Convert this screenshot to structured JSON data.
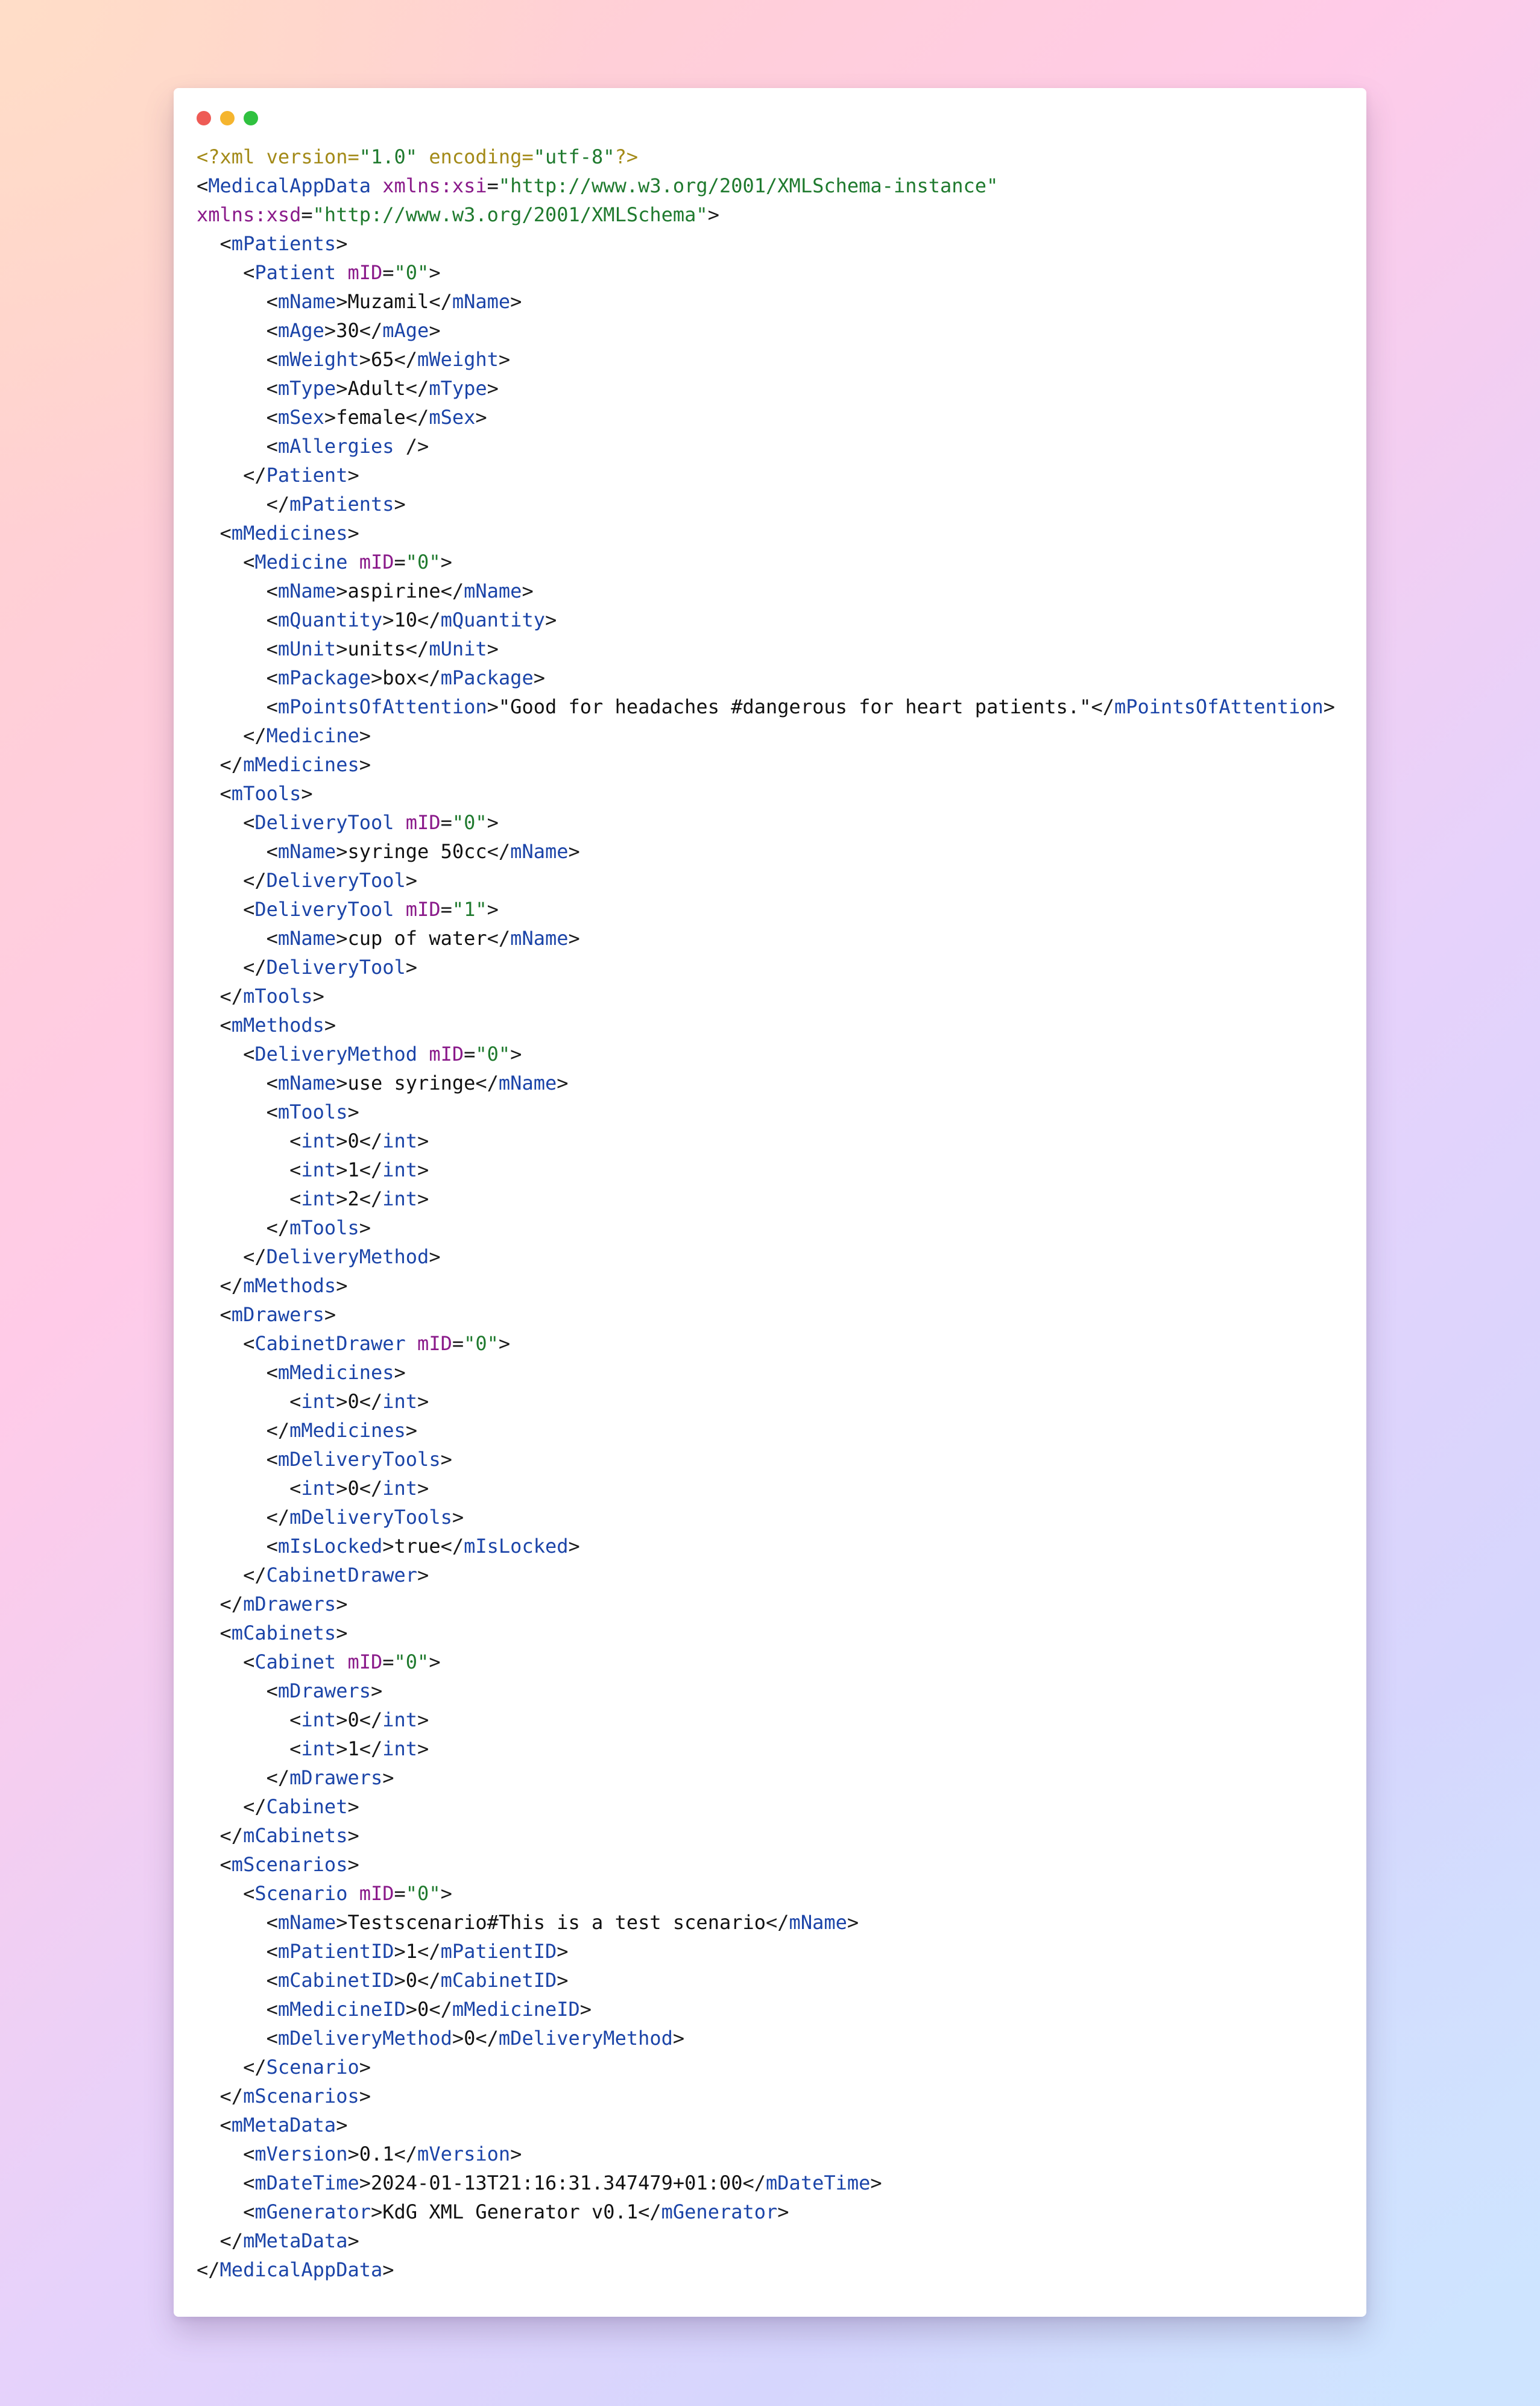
{
  "window": {
    "controls": [
      {
        "name": "close",
        "color": "#ee5b55"
      },
      {
        "name": "minimize",
        "color": "#f5b52e"
      },
      {
        "name": "maximize",
        "color": "#2fc13f"
      }
    ]
  },
  "colors": {
    "declaration": "#a38a18",
    "tag": "#1b44a8",
    "attribute": "#8a1a8a",
    "value": "#1f7a2e",
    "text": "#111111"
  },
  "code_lines": [
    [
      [
        "decl",
        "<?xml "
      ],
      [
        "decl",
        "version"
      ],
      [
        "decl",
        "="
      ],
      [
        "val",
        "\"1.0\""
      ],
      [
        "decl",
        " encoding"
      ],
      [
        "decl",
        "="
      ],
      [
        "val",
        "\"utf-8\""
      ],
      [
        "decl",
        "?>"
      ]
    ],
    [
      [
        "p",
        "<"
      ],
      [
        "tag",
        "MedicalAppData"
      ],
      [
        "p",
        " "
      ],
      [
        "attr",
        "xmlns:xsi"
      ],
      [
        "p",
        "="
      ],
      [
        "val",
        "\"http://www.w3.org/2001/XMLSchema-instance\""
      ]
    ],
    [
      [
        "attr",
        "xmlns:xsd"
      ],
      [
        "p",
        "="
      ],
      [
        "val",
        "\"http://www.w3.org/2001/XMLSchema\""
      ],
      [
        "p",
        ">"
      ]
    ],
    [
      [
        "p",
        "  <"
      ],
      [
        "tag",
        "mPatients"
      ],
      [
        "p",
        ">"
      ]
    ],
    [
      [
        "p",
        "    <"
      ],
      [
        "tag",
        "Patient"
      ],
      [
        "p",
        " "
      ],
      [
        "attr",
        "mID"
      ],
      [
        "p",
        "="
      ],
      [
        "val",
        "\"0\""
      ],
      [
        "p",
        ">"
      ]
    ],
    [
      [
        "p",
        "      <"
      ],
      [
        "tag",
        "mName"
      ],
      [
        "p",
        ">"
      ],
      [
        "text",
        "Muzamil"
      ],
      [
        "p",
        "</"
      ],
      [
        "tag",
        "mName"
      ],
      [
        "p",
        ">"
      ]
    ],
    [
      [
        "p",
        "      <"
      ],
      [
        "tag",
        "mAge"
      ],
      [
        "p",
        ">"
      ],
      [
        "text",
        "30"
      ],
      [
        "p",
        "</"
      ],
      [
        "tag",
        "mAge"
      ],
      [
        "p",
        ">"
      ]
    ],
    [
      [
        "p",
        "      <"
      ],
      [
        "tag",
        "mWeight"
      ],
      [
        "p",
        ">"
      ],
      [
        "text",
        "65"
      ],
      [
        "p",
        "</"
      ],
      [
        "tag",
        "mWeight"
      ],
      [
        "p",
        ">"
      ]
    ],
    [
      [
        "p",
        "      <"
      ],
      [
        "tag",
        "mType"
      ],
      [
        "p",
        ">"
      ],
      [
        "text",
        "Adult"
      ],
      [
        "p",
        "</"
      ],
      [
        "tag",
        "mType"
      ],
      [
        "p",
        ">"
      ]
    ],
    [
      [
        "p",
        "      <"
      ],
      [
        "tag",
        "mSex"
      ],
      [
        "p",
        ">"
      ],
      [
        "text",
        "female"
      ],
      [
        "p",
        "</"
      ],
      [
        "tag",
        "mSex"
      ],
      [
        "p",
        ">"
      ]
    ],
    [
      [
        "p",
        "      <"
      ],
      [
        "tag",
        "mAllergies"
      ],
      [
        "p",
        " />"
      ]
    ],
    [
      [
        "p",
        "    </"
      ],
      [
        "tag",
        "Patient"
      ],
      [
        "p",
        ">"
      ]
    ],
    [
      [
        "p",
        "      </"
      ],
      [
        "tag",
        "mPatients"
      ],
      [
        "p",
        ">"
      ]
    ],
    [
      [
        "p",
        "  <"
      ],
      [
        "tag",
        "mMedicines"
      ],
      [
        "p",
        ">"
      ]
    ],
    [
      [
        "p",
        "    <"
      ],
      [
        "tag",
        "Medicine"
      ],
      [
        "p",
        " "
      ],
      [
        "attr",
        "mID"
      ],
      [
        "p",
        "="
      ],
      [
        "val",
        "\"0\""
      ],
      [
        "p",
        ">"
      ]
    ],
    [
      [
        "p",
        "      <"
      ],
      [
        "tag",
        "mName"
      ],
      [
        "p",
        ">"
      ],
      [
        "text",
        "aspirine"
      ],
      [
        "p",
        "</"
      ],
      [
        "tag",
        "mName"
      ],
      [
        "p",
        ">"
      ]
    ],
    [
      [
        "p",
        "      <"
      ],
      [
        "tag",
        "mQuantity"
      ],
      [
        "p",
        ">"
      ],
      [
        "text",
        "10"
      ],
      [
        "p",
        "</"
      ],
      [
        "tag",
        "mQuantity"
      ],
      [
        "p",
        ">"
      ]
    ],
    [
      [
        "p",
        "      <"
      ],
      [
        "tag",
        "mUnit"
      ],
      [
        "p",
        ">"
      ],
      [
        "text",
        "units"
      ],
      [
        "p",
        "</"
      ],
      [
        "tag",
        "mUnit"
      ],
      [
        "p",
        ">"
      ]
    ],
    [
      [
        "p",
        "      <"
      ],
      [
        "tag",
        "mPackage"
      ],
      [
        "p",
        ">"
      ],
      [
        "text",
        "box"
      ],
      [
        "p",
        "</"
      ],
      [
        "tag",
        "mPackage"
      ],
      [
        "p",
        ">"
      ]
    ],
    [
      [
        "p",
        "      <"
      ],
      [
        "tag",
        "mPointsOfAttention"
      ],
      [
        "p",
        ">"
      ],
      [
        "text",
        "\"Good for headaches #dangerous for heart patients.\""
      ],
      [
        "p",
        "</"
      ],
      [
        "tag",
        "mPointsOfAttention"
      ],
      [
        "p",
        ">"
      ]
    ],
    [
      [
        "p",
        "    </"
      ],
      [
        "tag",
        "Medicine"
      ],
      [
        "p",
        ">"
      ]
    ],
    [
      [
        "p",
        "  </"
      ],
      [
        "tag",
        "mMedicines"
      ],
      [
        "p",
        ">"
      ]
    ],
    [
      [
        "p",
        "  <"
      ],
      [
        "tag",
        "mTools"
      ],
      [
        "p",
        ">"
      ]
    ],
    [
      [
        "p",
        "    <"
      ],
      [
        "tag",
        "DeliveryTool"
      ],
      [
        "p",
        " "
      ],
      [
        "attr",
        "mID"
      ],
      [
        "p",
        "="
      ],
      [
        "val",
        "\"0\""
      ],
      [
        "p",
        ">"
      ]
    ],
    [
      [
        "p",
        "      <"
      ],
      [
        "tag",
        "mName"
      ],
      [
        "p",
        ">"
      ],
      [
        "text",
        "syringe 50cc"
      ],
      [
        "p",
        "</"
      ],
      [
        "tag",
        "mName"
      ],
      [
        "p",
        ">"
      ]
    ],
    [
      [
        "p",
        "    </"
      ],
      [
        "tag",
        "DeliveryTool"
      ],
      [
        "p",
        ">"
      ]
    ],
    [
      [
        "p",
        "    <"
      ],
      [
        "tag",
        "DeliveryTool"
      ],
      [
        "p",
        " "
      ],
      [
        "attr",
        "mID"
      ],
      [
        "p",
        "="
      ],
      [
        "val",
        "\"1\""
      ],
      [
        "p",
        ">"
      ]
    ],
    [
      [
        "p",
        "      <"
      ],
      [
        "tag",
        "mName"
      ],
      [
        "p",
        ">"
      ],
      [
        "text",
        "cup of water"
      ],
      [
        "p",
        "</"
      ],
      [
        "tag",
        "mName"
      ],
      [
        "p",
        ">"
      ]
    ],
    [
      [
        "p",
        "    </"
      ],
      [
        "tag",
        "DeliveryTool"
      ],
      [
        "p",
        ">"
      ]
    ],
    [
      [
        "p",
        "  </"
      ],
      [
        "tag",
        "mTools"
      ],
      [
        "p",
        ">"
      ]
    ],
    [
      [
        "p",
        "  <"
      ],
      [
        "tag",
        "mMethods"
      ],
      [
        "p",
        ">"
      ]
    ],
    [
      [
        "p",
        "    <"
      ],
      [
        "tag",
        "DeliveryMethod"
      ],
      [
        "p",
        " "
      ],
      [
        "attr",
        "mID"
      ],
      [
        "p",
        "="
      ],
      [
        "val",
        "\"0\""
      ],
      [
        "p",
        ">"
      ]
    ],
    [
      [
        "p",
        "      <"
      ],
      [
        "tag",
        "mName"
      ],
      [
        "p",
        ">"
      ],
      [
        "text",
        "use syringe"
      ],
      [
        "p",
        "</"
      ],
      [
        "tag",
        "mName"
      ],
      [
        "p",
        ">"
      ]
    ],
    [
      [
        "p",
        "      <"
      ],
      [
        "tag",
        "mTools"
      ],
      [
        "p",
        ">"
      ]
    ],
    [
      [
        "p",
        "        <"
      ],
      [
        "tag",
        "int"
      ],
      [
        "p",
        ">"
      ],
      [
        "text",
        "0"
      ],
      [
        "p",
        "</"
      ],
      [
        "tag",
        "int"
      ],
      [
        "p",
        ">"
      ]
    ],
    [
      [
        "p",
        "        <"
      ],
      [
        "tag",
        "int"
      ],
      [
        "p",
        ">"
      ],
      [
        "text",
        "1"
      ],
      [
        "p",
        "</"
      ],
      [
        "tag",
        "int"
      ],
      [
        "p",
        ">"
      ]
    ],
    [
      [
        "p",
        "        <"
      ],
      [
        "tag",
        "int"
      ],
      [
        "p",
        ">"
      ],
      [
        "text",
        "2"
      ],
      [
        "p",
        "</"
      ],
      [
        "tag",
        "int"
      ],
      [
        "p",
        ">"
      ]
    ],
    [
      [
        "p",
        "      </"
      ],
      [
        "tag",
        "mTools"
      ],
      [
        "p",
        ">"
      ]
    ],
    [
      [
        "p",
        "    </"
      ],
      [
        "tag",
        "DeliveryMethod"
      ],
      [
        "p",
        ">"
      ]
    ],
    [
      [
        "p",
        "  </"
      ],
      [
        "tag",
        "mMethods"
      ],
      [
        "p",
        ">"
      ]
    ],
    [
      [
        "p",
        "  <"
      ],
      [
        "tag",
        "mDrawers"
      ],
      [
        "p",
        ">"
      ]
    ],
    [
      [
        "p",
        "    <"
      ],
      [
        "tag",
        "CabinetDrawer"
      ],
      [
        "p",
        " "
      ],
      [
        "attr",
        "mID"
      ],
      [
        "p",
        "="
      ],
      [
        "val",
        "\"0\""
      ],
      [
        "p",
        ">"
      ]
    ],
    [
      [
        "p",
        "      <"
      ],
      [
        "tag",
        "mMedicines"
      ],
      [
        "p",
        ">"
      ]
    ],
    [
      [
        "p",
        "        <"
      ],
      [
        "tag",
        "int"
      ],
      [
        "p",
        ">"
      ],
      [
        "text",
        "0"
      ],
      [
        "p",
        "</"
      ],
      [
        "tag",
        "int"
      ],
      [
        "p",
        ">"
      ]
    ],
    [
      [
        "p",
        "      </"
      ],
      [
        "tag",
        "mMedicines"
      ],
      [
        "p",
        ">"
      ]
    ],
    [
      [
        "p",
        "      <"
      ],
      [
        "tag",
        "mDeliveryTools"
      ],
      [
        "p",
        ">"
      ]
    ],
    [
      [
        "p",
        "        <"
      ],
      [
        "tag",
        "int"
      ],
      [
        "p",
        ">"
      ],
      [
        "text",
        "0"
      ],
      [
        "p",
        "</"
      ],
      [
        "tag",
        "int"
      ],
      [
        "p",
        ">"
      ]
    ],
    [
      [
        "p",
        "      </"
      ],
      [
        "tag",
        "mDeliveryTools"
      ],
      [
        "p",
        ">"
      ]
    ],
    [
      [
        "p",
        "      <"
      ],
      [
        "tag",
        "mIsLocked"
      ],
      [
        "p",
        ">"
      ],
      [
        "text",
        "true"
      ],
      [
        "p",
        "</"
      ],
      [
        "tag",
        "mIsLocked"
      ],
      [
        "p",
        ">"
      ]
    ],
    [
      [
        "p",
        "    </"
      ],
      [
        "tag",
        "CabinetDrawer"
      ],
      [
        "p",
        ">"
      ]
    ],
    [
      [
        "p",
        "  </"
      ],
      [
        "tag",
        "mDrawers"
      ],
      [
        "p",
        ">"
      ]
    ],
    [
      [
        "p",
        "  <"
      ],
      [
        "tag",
        "mCabinets"
      ],
      [
        "p",
        ">"
      ]
    ],
    [
      [
        "p",
        "    <"
      ],
      [
        "tag",
        "Cabinet"
      ],
      [
        "p",
        " "
      ],
      [
        "attr",
        "mID"
      ],
      [
        "p",
        "="
      ],
      [
        "val",
        "\"0\""
      ],
      [
        "p",
        ">"
      ]
    ],
    [
      [
        "p",
        "      <"
      ],
      [
        "tag",
        "mDrawers"
      ],
      [
        "p",
        ">"
      ]
    ],
    [
      [
        "p",
        "        <"
      ],
      [
        "tag",
        "int"
      ],
      [
        "p",
        ">"
      ],
      [
        "text",
        "0"
      ],
      [
        "p",
        "</"
      ],
      [
        "tag",
        "int"
      ],
      [
        "p",
        ">"
      ]
    ],
    [
      [
        "p",
        "        <"
      ],
      [
        "tag",
        "int"
      ],
      [
        "p",
        ">"
      ],
      [
        "text",
        "1"
      ],
      [
        "p",
        "</"
      ],
      [
        "tag",
        "int"
      ],
      [
        "p",
        ">"
      ]
    ],
    [
      [
        "p",
        "      </"
      ],
      [
        "tag",
        "mDrawers"
      ],
      [
        "p",
        ">"
      ]
    ],
    [
      [
        "p",
        "    </"
      ],
      [
        "tag",
        "Cabinet"
      ],
      [
        "p",
        ">"
      ]
    ],
    [
      [
        "p",
        "  </"
      ],
      [
        "tag",
        "mCabinets"
      ],
      [
        "p",
        ">"
      ]
    ],
    [
      [
        "p",
        "  <"
      ],
      [
        "tag",
        "mScenarios"
      ],
      [
        "p",
        ">"
      ]
    ],
    [
      [
        "p",
        "    <"
      ],
      [
        "tag",
        "Scenario"
      ],
      [
        "p",
        " "
      ],
      [
        "attr",
        "mID"
      ],
      [
        "p",
        "="
      ],
      [
        "val",
        "\"0\""
      ],
      [
        "p",
        ">"
      ]
    ],
    [
      [
        "p",
        "      <"
      ],
      [
        "tag",
        "mName"
      ],
      [
        "p",
        ">"
      ],
      [
        "text",
        "Testscenario#This is a test scenario"
      ],
      [
        "p",
        "</"
      ],
      [
        "tag",
        "mName"
      ],
      [
        "p",
        ">"
      ]
    ],
    [
      [
        "p",
        "      <"
      ],
      [
        "tag",
        "mPatientID"
      ],
      [
        "p",
        ">"
      ],
      [
        "text",
        "1"
      ],
      [
        "p",
        "</"
      ],
      [
        "tag",
        "mPatientID"
      ],
      [
        "p",
        ">"
      ]
    ],
    [
      [
        "p",
        "      <"
      ],
      [
        "tag",
        "mCabinetID"
      ],
      [
        "p",
        ">"
      ],
      [
        "text",
        "0"
      ],
      [
        "p",
        "</"
      ],
      [
        "tag",
        "mCabinetID"
      ],
      [
        "p",
        ">"
      ]
    ],
    [
      [
        "p",
        "      <"
      ],
      [
        "tag",
        "mMedicineID"
      ],
      [
        "p",
        ">"
      ],
      [
        "text",
        "0"
      ],
      [
        "p",
        "</"
      ],
      [
        "tag",
        "mMedicineID"
      ],
      [
        "p",
        ">"
      ]
    ],
    [
      [
        "p",
        "      <"
      ],
      [
        "tag",
        "mDeliveryMethod"
      ],
      [
        "p",
        ">"
      ],
      [
        "text",
        "0"
      ],
      [
        "p",
        "</"
      ],
      [
        "tag",
        "mDeliveryMethod"
      ],
      [
        "p",
        ">"
      ]
    ],
    [
      [
        "p",
        "    </"
      ],
      [
        "tag",
        "Scenario"
      ],
      [
        "p",
        ">"
      ]
    ],
    [
      [
        "p",
        "  </"
      ],
      [
        "tag",
        "mScenarios"
      ],
      [
        "p",
        ">"
      ]
    ],
    [
      [
        "p",
        "  <"
      ],
      [
        "tag",
        "mMetaData"
      ],
      [
        "p",
        ">"
      ]
    ],
    [
      [
        "p",
        "    <"
      ],
      [
        "tag",
        "mVersion"
      ],
      [
        "p",
        ">"
      ],
      [
        "text",
        "0.1"
      ],
      [
        "p",
        "</"
      ],
      [
        "tag",
        "mVersion"
      ],
      [
        "p",
        ">"
      ]
    ],
    [
      [
        "p",
        "    <"
      ],
      [
        "tag",
        "mDateTime"
      ],
      [
        "p",
        ">"
      ],
      [
        "text",
        "2024-01-13T21:16:31.347479+01:00"
      ],
      [
        "p",
        "</"
      ],
      [
        "tag",
        "mDateTime"
      ],
      [
        "p",
        ">"
      ]
    ],
    [
      [
        "p",
        "    <"
      ],
      [
        "tag",
        "mGenerator"
      ],
      [
        "p",
        ">"
      ],
      [
        "text",
        "KdG XML Generator v0.1"
      ],
      [
        "p",
        "</"
      ],
      [
        "tag",
        "mGenerator"
      ],
      [
        "p",
        ">"
      ]
    ],
    [
      [
        "p",
        "  </"
      ],
      [
        "tag",
        "mMetaData"
      ],
      [
        "p",
        ">"
      ]
    ],
    [
      [
        "p",
        "</"
      ],
      [
        "tag",
        "MedicalAppData"
      ],
      [
        "p",
        ">"
      ]
    ]
  ]
}
